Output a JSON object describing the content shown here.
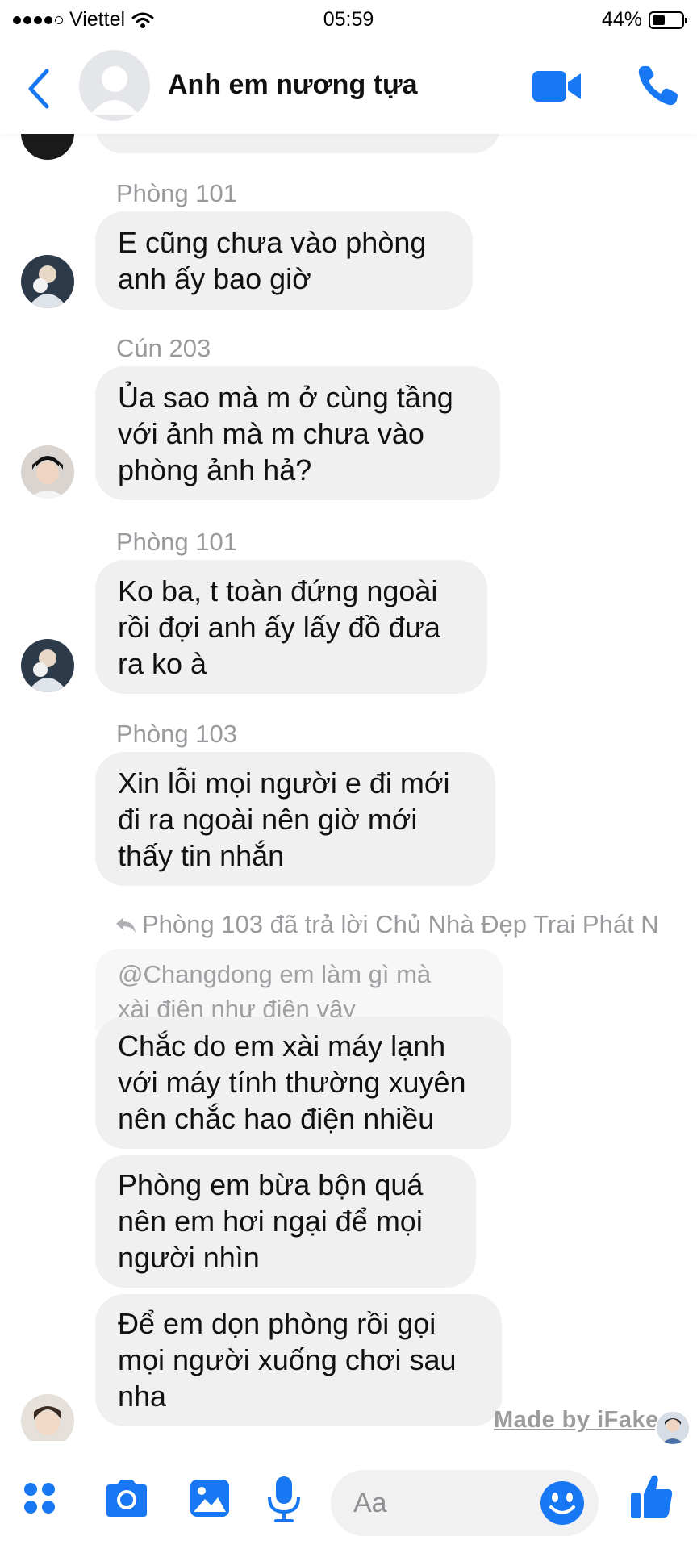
{
  "status_bar": {
    "carrier": "Viettel",
    "time": "05:59",
    "battery_percent": "44%",
    "battery_level": 0.44
  },
  "header": {
    "title": "Anh em nương tựa",
    "accent_color": "#1877f2"
  },
  "messages": [
    {
      "sender": "Phòng 101",
      "lines": [
        "E cũng chưa vào phòng",
        "anh ấy bao giờ"
      ]
    },
    {
      "sender": "Cún 203",
      "lines": [
        "Ủa sao mà m ở cùng tầng",
        "với ảnh mà m chưa vào",
        "phòng ảnh hả?"
      ]
    },
    {
      "sender": "Phòng 101",
      "lines": [
        "Ko ba, t toàn đứng ngoài",
        "rồi đợi anh ấy lấy đồ đưa",
        "ra ko à"
      ]
    },
    {
      "sender": "Phòng 103",
      "lines": [
        "Xin lỗi mọi người e đi mới",
        "đi ra ngoài nên giờ mới",
        "thấy tin nhắn"
      ]
    }
  ],
  "reply": {
    "note": "Phòng 103 đã trả lời Chủ Nhà Đẹp Trai Phát N",
    "quoted_lines": [
      "@Changdong em làm gì mà",
      "xài điện như điên vậy"
    ]
  },
  "reply_messages": [
    {
      "lines": [
        "Chắc do em xài máy lạnh",
        "với máy tính thường xuyên",
        "nên chắc hao điện nhiều"
      ]
    },
    {
      "lines": [
        "Phòng em bừa bộn quá",
        "nên em hơi ngại để mọi",
        "người nhìn"
      ]
    },
    {
      "lines": [
        "Để em dọn phòng rồi gọi",
        "mọi người xuống chơi sau",
        "nha"
      ]
    }
  ],
  "watermark": "Made by iFake",
  "composer": {
    "placeholder": "Aa"
  },
  "icons": [
    "menu-dots-icon",
    "camera-icon",
    "photo-icon",
    "microphone-icon",
    "emoji-icon",
    "like-icon",
    "video-call-icon",
    "phone-icon",
    "back-chevron-icon",
    "wifi-icon",
    "reply-arrow-icon"
  ]
}
